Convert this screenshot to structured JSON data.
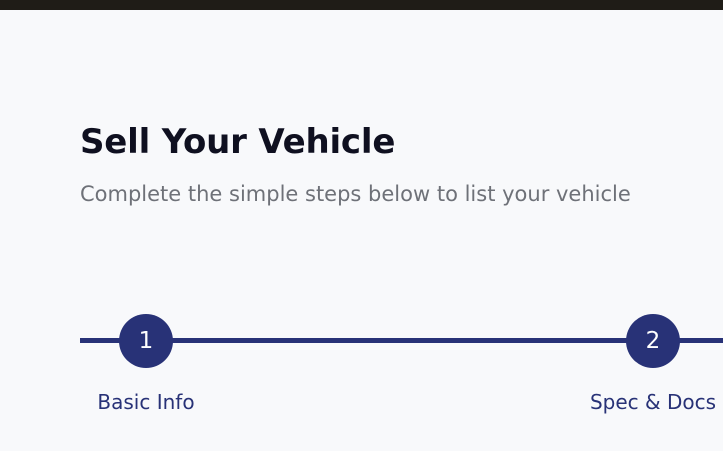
{
  "header": {
    "title": "Sell Your Vehicle",
    "subtitle": "Complete the simple steps below to list your vehicle"
  },
  "stepper": {
    "steps": [
      {
        "number": "1",
        "label": "Basic Info"
      },
      {
        "number": "2",
        "label": "Spec & Docs"
      }
    ]
  },
  "colors": {
    "accent": "#283277",
    "title": "#0f1020",
    "subtitle": "#6e7178",
    "background": "#f8f9fb"
  }
}
